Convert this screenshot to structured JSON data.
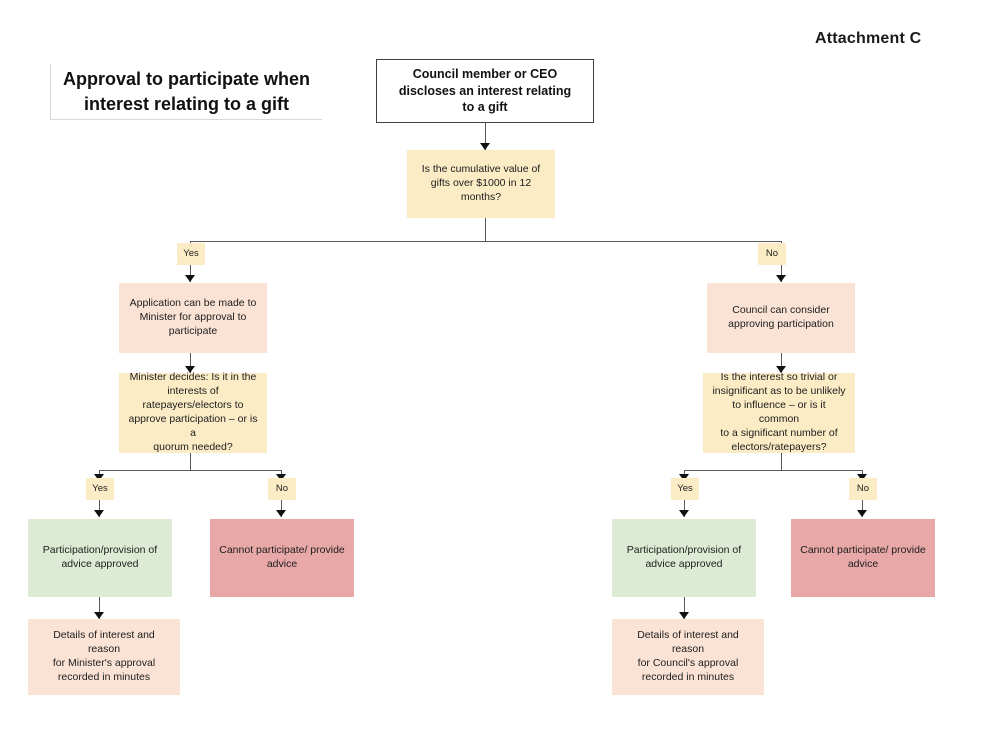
{
  "document": {
    "attachment_label": "Attachment C",
    "main_heading": "Approval to participate when\ninterest relating to a gift"
  },
  "flowchart": {
    "type": "flowchart",
    "title": "Approval to participate when interest relating to a gift",
    "nodes": {
      "start": {
        "id": "start",
        "kind": "start",
        "text": "Council member or CEO\ndiscloses an interest relating\nto a gift",
        "color": "#ffffff"
      },
      "decision_value": {
        "id": "decision_value",
        "kind": "decision",
        "text": "Is the cumulative value of\ngifts over $1000 in 12\nmonths?",
        "color": "#fbecc6"
      },
      "branch_yes_top": {
        "id": "branch_yes_top",
        "kind": "label",
        "text": "Yes",
        "color": "#fbecc6"
      },
      "branch_no_top": {
        "id": "branch_no_top",
        "kind": "label",
        "text": "No",
        "color": "#fbecc6"
      },
      "application_minister": {
        "id": "application_minister",
        "kind": "process",
        "text": "Application can be made to\nMinister for approval to\nparticipate",
        "color": "#fae3d5"
      },
      "council_consider": {
        "id": "council_consider",
        "kind": "process",
        "text": "Council can consider\napproving participation",
        "color": "#fae3d5"
      },
      "decision_minister": {
        "id": "decision_minister",
        "kind": "decision",
        "text": "Minister decides: Is it in the\ninterests of\nratepayers/electors to\napprove participation – or is a\nquorum needed?",
        "color": "#fbecc6"
      },
      "decision_trivial": {
        "id": "decision_trivial",
        "kind": "decision",
        "text": "Is the interest so trivial or\ninsignificant as to be unlikely\nto influence – or is it common\nto a significant number of\nelectors/ratepayers?",
        "color": "#fbecc6"
      },
      "left_yes": {
        "id": "left_yes",
        "kind": "label",
        "text": "Yes",
        "color": "#fbecc6"
      },
      "left_no": {
        "id": "left_no",
        "kind": "label",
        "text": "No",
        "color": "#fbecc6"
      },
      "right_yes": {
        "id": "right_yes",
        "kind": "label",
        "text": "Yes",
        "color": "#fbecc6"
      },
      "right_no": {
        "id": "right_no",
        "kind": "label",
        "text": "No",
        "color": "#fbecc6"
      },
      "left_approved": {
        "id": "left_approved",
        "kind": "approved",
        "text": "Participation/provision of\nadvice approved",
        "color": "#deebd4"
      },
      "left_denied": {
        "id": "left_denied",
        "kind": "denied",
        "text": "Cannot participate/ provide\nadvice",
        "color": "#e8a8a8"
      },
      "right_approved": {
        "id": "right_approved",
        "kind": "approved",
        "text": "Participation/provision of\nadvice approved",
        "color": "#deebd4"
      },
      "right_denied": {
        "id": "right_denied",
        "kind": "denied",
        "text": "Cannot participate/ provide\nadvice",
        "color": "#e8a8a8"
      },
      "left_record": {
        "id": "left_record",
        "kind": "process",
        "text": "Details of interest and reason\nfor Minister's approval\nrecorded in minutes",
        "color": "#fae3d5"
      },
      "right_record": {
        "id": "right_record",
        "kind": "process",
        "text": "Details of interest and reason\nfor Council's approval\nrecorded in minutes",
        "color": "#fae3d5"
      }
    }
  }
}
